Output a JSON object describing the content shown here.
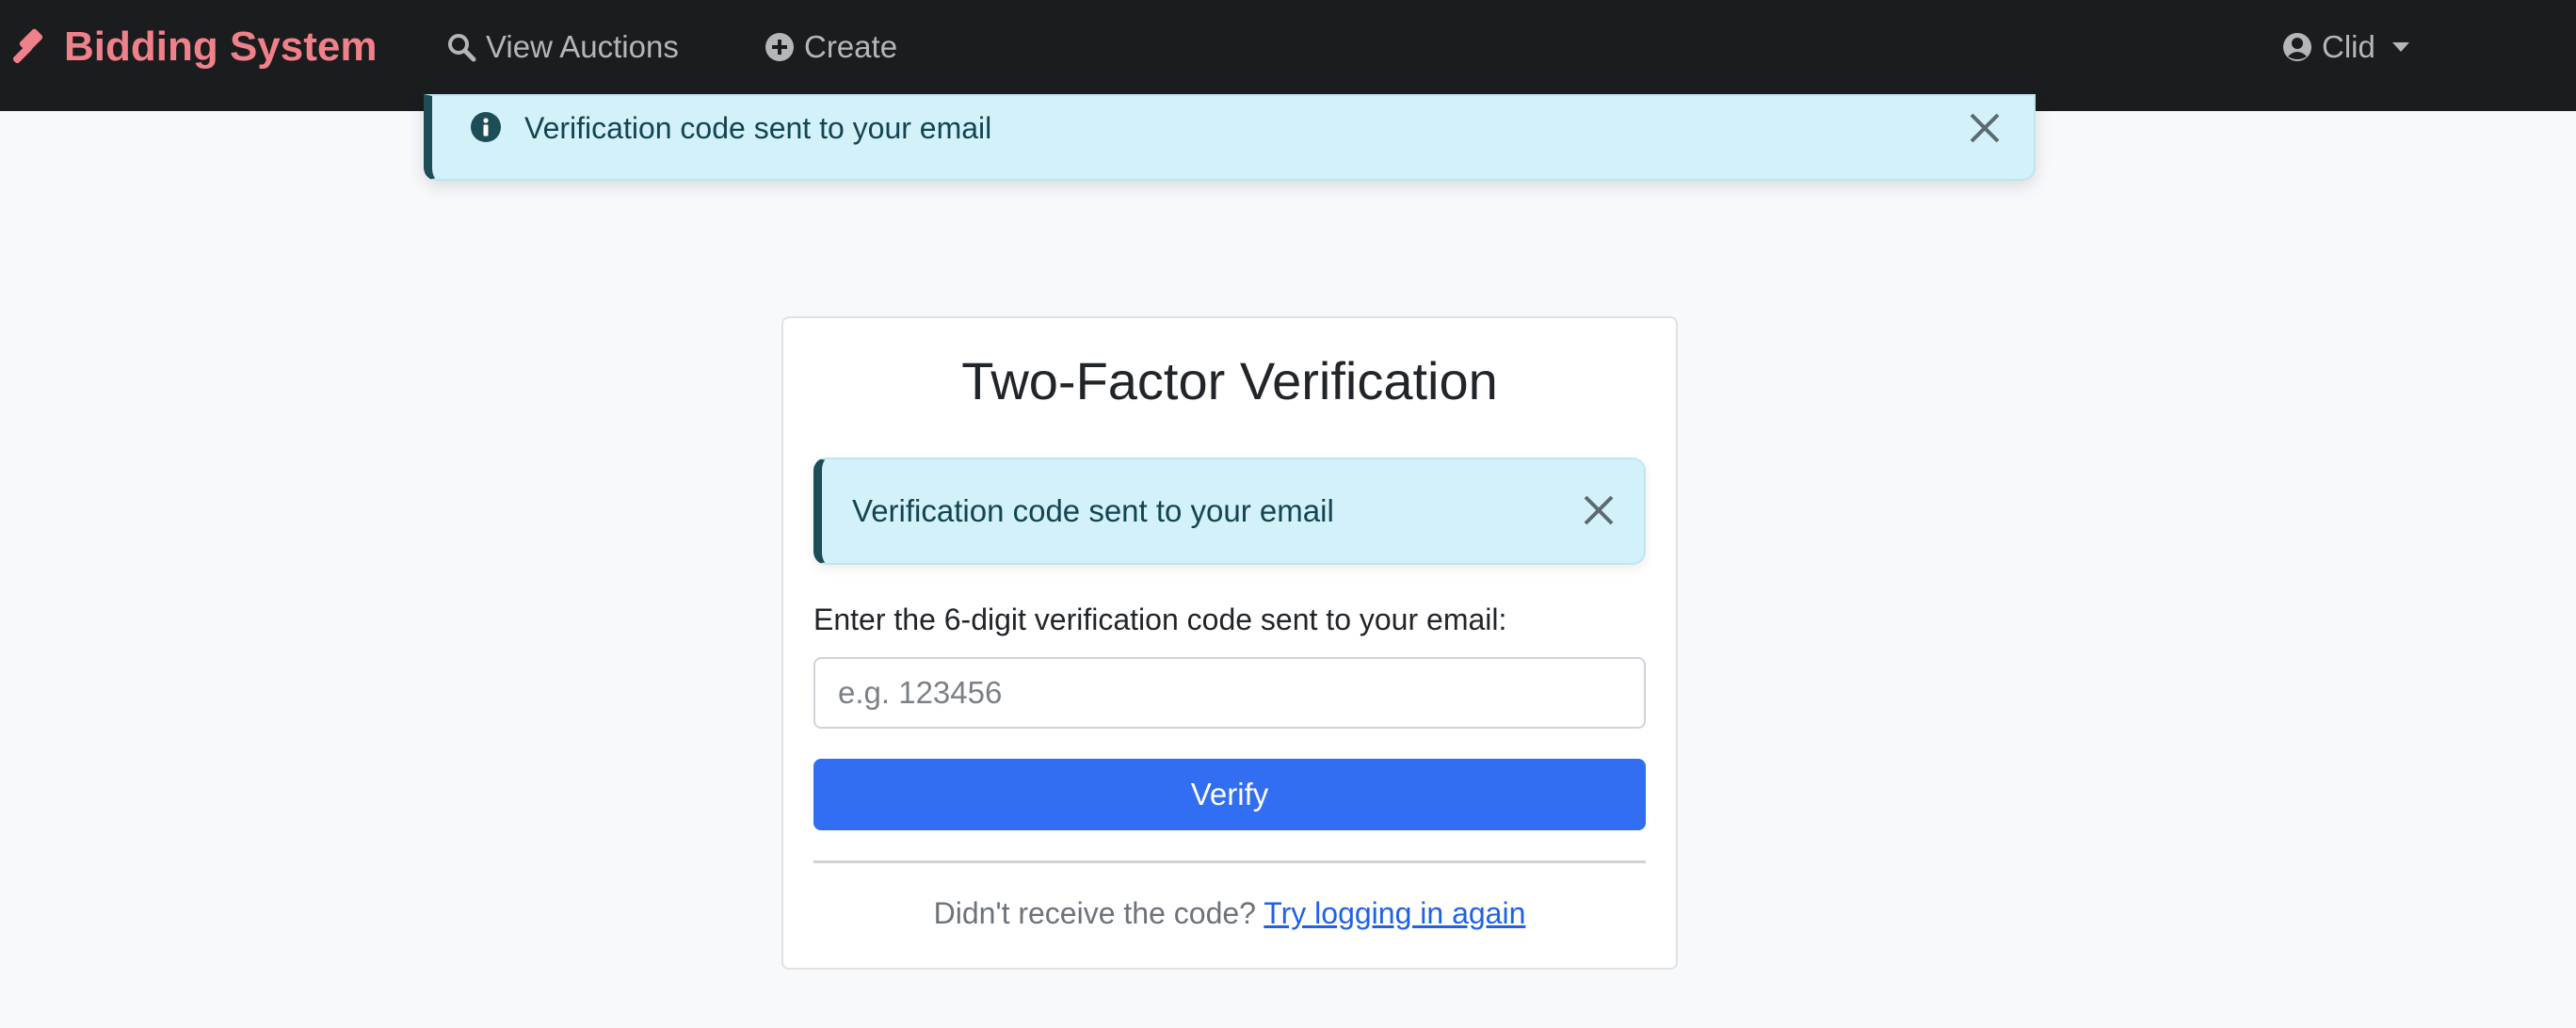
{
  "navbar": {
    "brand": "Bidding System",
    "brand_color": "#f0808a",
    "brand_icon": "gavel-icon",
    "links": [
      {
        "label": "View Auctions",
        "icon": "search-icon"
      },
      {
        "label": "Create",
        "icon": "plus-circle-icon"
      }
    ],
    "user": {
      "label": "Clid",
      "icon": "user-circle-icon"
    }
  },
  "toast": {
    "message": "Verification code sent to your email",
    "icon": "info-circle-icon",
    "close_icon": "close-icon"
  },
  "card": {
    "title": "Two-Factor Verification",
    "alert": {
      "message": "Verification code sent to your email",
      "close_icon": "close-icon"
    },
    "label": "Enter the 6-digit verification code sent to your email:",
    "input": {
      "placeholder": "e.g. 123456",
      "value": ""
    },
    "button": "Verify",
    "button_color": "#316ef1",
    "footer_text": "Didn't receive the code?",
    "footer_link": "Try logging in again"
  }
}
